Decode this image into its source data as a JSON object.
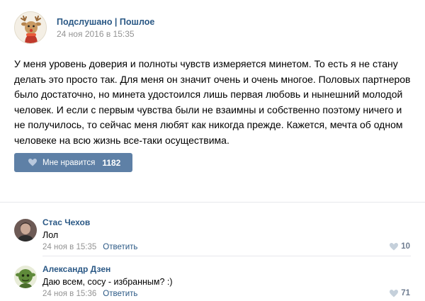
{
  "post": {
    "group_name": "Подслушано | Пошлое",
    "date": "24 ноя 2016 в 15:35",
    "text": "У меня уровень доверия и полноты чувств измеряется минетом. То есть я не стану делать это просто так. Для меня он значит очень и очень многое. Половых партнеров было достаточно, но минета удостоился лишь первая любовь и нынешний молодой человек. И если с первым чувства были не взаимны и собственно поэтому ничего и не получилось, то сейчас меня любят как никогда прежде. Кажется, мечта об одном человеке на всю жизнь все-таки осуществима.",
    "like_label": "Мне нравится",
    "like_count": "1182",
    "like_icon": "heart-icon"
  },
  "comments": [
    {
      "author": "Стас Чехов",
      "text": "Лол",
      "date": "24 ноя в 15:35",
      "reply_label": "Ответить",
      "likes": "10"
    },
    {
      "author": "Александр Дзен",
      "text": "Даю всем, сосу - избранным? :)",
      "date": "24 ноя в 15:36",
      "reply_label": "Ответить",
      "likes": "71"
    }
  ],
  "colors": {
    "link": "#2a5885",
    "button": "#5e80a6",
    "muted": "#939393",
    "divider": "#e7e8ec"
  }
}
